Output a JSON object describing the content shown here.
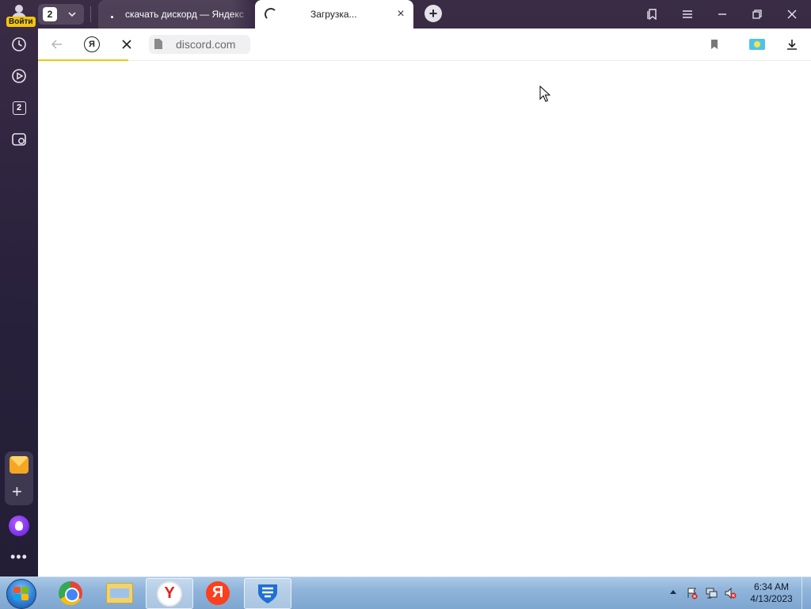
{
  "browser": {
    "sidebar": {
      "login_label": "Войти",
      "tab_count": "2",
      "icons": [
        "history-icon",
        "play-icon",
        "tabs-count-icon",
        "screenshot-icon",
        "mail-icon",
        "add-icon",
        "alice-icon",
        "more-icon"
      ]
    },
    "tabs": {
      "count": "2",
      "items": [
        {
          "title": "скачать дискорд — Яндекс",
          "active": false
        },
        {
          "title": "Загрузка...",
          "active": true,
          "loading": true
        }
      ]
    },
    "address_bar": {
      "url": "discord.com",
      "loading": true
    },
    "colors": {
      "accent": "#f2c40e",
      "chrome_dark": "#2f2540"
    }
  },
  "taskbar": {
    "apps": [
      "start",
      "google-chrome",
      "file-explorer",
      "yandex-browser",
      "yandex",
      "app-shield"
    ],
    "clock": {
      "time": "6:34 AM",
      "date": "4/13/2023"
    }
  }
}
